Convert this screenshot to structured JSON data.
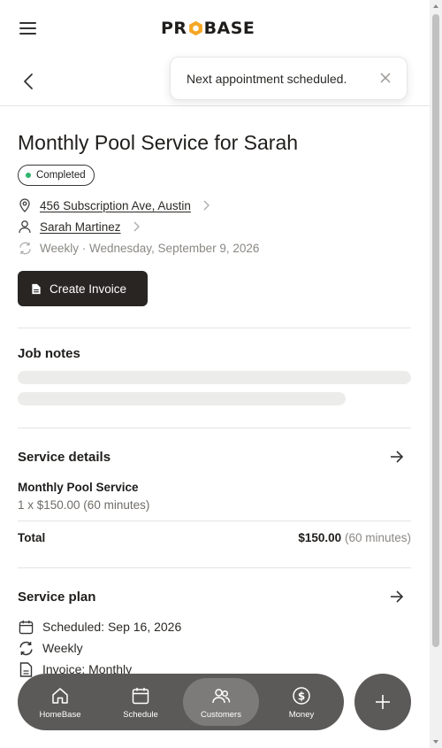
{
  "header": {
    "logo_text": "PROBASE",
    "logo_pre": "PR",
    "logo_post": "BASE",
    "brand_accent": "#f5a623"
  },
  "toast": {
    "message": "Next appointment scheduled."
  },
  "job": {
    "title": "Monthly Pool Service for Sarah",
    "status": "Completed",
    "status_color": "#2fb36a",
    "address": "456 Subscription Ave, Austin",
    "customer": "Sarah Martinez",
    "recurrence": "Weekly · Wednesday, September 9, 2026"
  },
  "actions": {
    "create_invoice_label": "Create Invoice"
  },
  "job_notes": {
    "heading": "Job notes"
  },
  "service_details": {
    "heading": "Service details",
    "item_name": "Monthly Pool Service",
    "item_meta": "1 x $150.00 (60 minutes)",
    "total_label": "Total",
    "total_amount": "$150.00",
    "total_duration": "(60 minutes)"
  },
  "service_plan": {
    "heading": "Service plan",
    "scheduled": "Scheduled: Sep 16, 2026",
    "frequency": "Weekly",
    "invoice": "Invoice: Monthly"
  },
  "bottom_nav": {
    "items": [
      {
        "label": "HomeBase",
        "icon": "home-icon"
      },
      {
        "label": "Schedule",
        "icon": "calendar-icon"
      },
      {
        "label": "Customers",
        "icon": "users-icon",
        "active": true
      },
      {
        "label": "Money",
        "icon": "dollar-icon"
      }
    ]
  },
  "fab": {
    "icon": "plus-icon"
  }
}
